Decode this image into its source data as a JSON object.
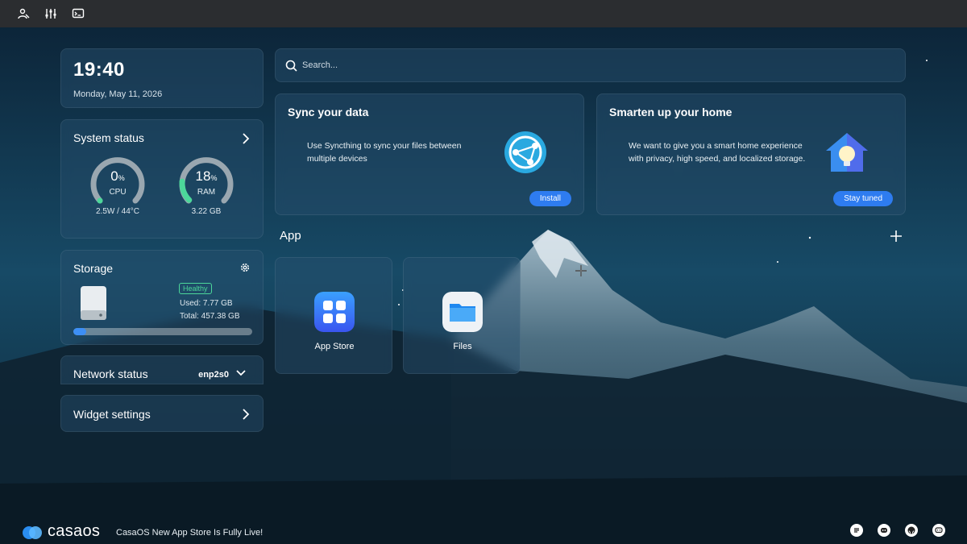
{
  "topbar": {
    "icons": [
      "account-icon",
      "settings-sliders-icon",
      "terminal-icon"
    ]
  },
  "clock": {
    "time": "19:40",
    "date": "Monday, May 11, 2026"
  },
  "system_status": {
    "title": "System status",
    "cpu": {
      "value": "0",
      "unit": "%",
      "label": "CPU",
      "detail": "2.5W / 44°C",
      "percent": 0
    },
    "ram": {
      "value": "18",
      "unit": "%",
      "label": "RAM",
      "detail": "3.22 GB",
      "percent": 18
    }
  },
  "storage": {
    "title": "Storage",
    "status": "Healthy",
    "used": "Used: 7.77 GB",
    "total": "Total: 457.38 GB",
    "fill_percent": 7
  },
  "network": {
    "title": "Network status",
    "interface": "enp2s0"
  },
  "widget_settings": {
    "title": "Widget settings"
  },
  "search": {
    "placeholder": "Search..."
  },
  "promos": [
    {
      "title": "Sync your data",
      "description": "Use Syncthing to sync your files between multiple devices",
      "button": "Install"
    },
    {
      "title": "Smarten up your home",
      "description": "We want to give you a smart home experience with privacy, high speed, and localized storage.",
      "button": "Stay tuned"
    }
  ],
  "apps": {
    "header": "App",
    "items": [
      {
        "label": "App Store",
        "icon": "app-store-icon"
      },
      {
        "label": "Files",
        "icon": "folder-icon"
      }
    ]
  },
  "footer": {
    "logo_text": "casaos",
    "news": "CasaOS New App Store Is Fully Live!",
    "social": [
      "forum-icon",
      "discord-icon",
      "github-icon",
      "chat-icon"
    ]
  },
  "colors": {
    "accent": "#2e7cf0",
    "cpu_gauge": "#4cd79a",
    "ram_gauge": "#4cd79a",
    "healthy": "#4cd79a"
  }
}
